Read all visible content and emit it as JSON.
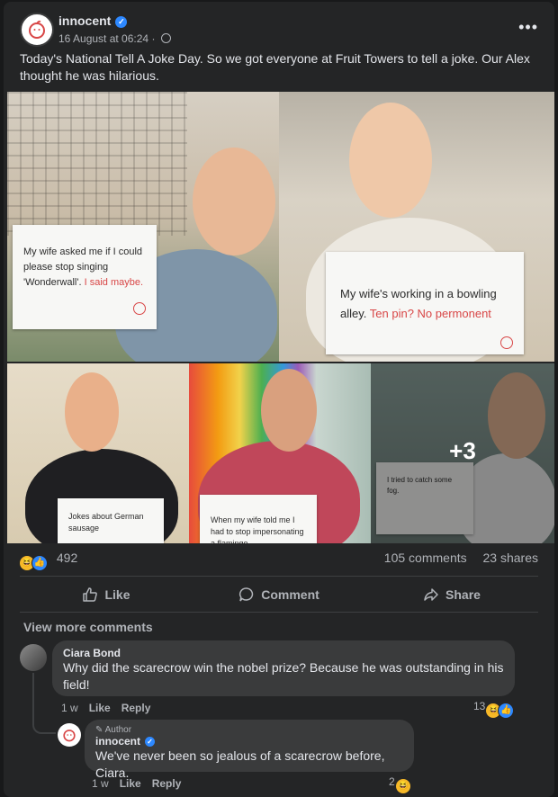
{
  "post": {
    "page_name": "innocent",
    "timestamp": "16 August at 06:24",
    "separator": "·",
    "more_menu": "•••",
    "text": "Today's National Tell A Joke Day. So we got everyone at Fruit Towers to tell a joke. Our Alex thought he was hilarious."
  },
  "photos": [
    {
      "sign_text": "My wife asked me if I could please stop singing 'Wonderwall'.",
      "sign_punchline": "I said maybe."
    },
    {
      "sign_text": "My wife's working in a bowling alley.",
      "sign_punchline": "Ten pin? No permonent"
    },
    {
      "sign_text": "Jokes about German sausage",
      "sign_punchline": ""
    },
    {
      "sign_text": "When my wife told me I had to stop impersonating a flamingo,",
      "sign_punchline": ""
    },
    {
      "sign_text": "I tried to catch some fog.",
      "sign_punchline": ""
    }
  ],
  "more_photos_label": "+3",
  "reactions": {
    "count": "492",
    "comments": "105 comments",
    "shares": "23 shares"
  },
  "actions": {
    "like": "Like",
    "comment": "Comment",
    "share": "Share"
  },
  "view_more_comments": "View more comments",
  "comments": [
    {
      "author": "Ciara Bond",
      "text": "Why did the scarecrow win the nobel prize? Because he was outstanding in his field!",
      "time": "1 w",
      "like": "Like",
      "reply": "Reply",
      "reaction_count": "13"
    },
    {
      "badge": "Author",
      "author": "innocent",
      "text": "We've never been so jealous of a scarecrow before, Ciara.",
      "time": "1 w",
      "like": "Like",
      "reply": "Reply",
      "reaction_count": "2"
    }
  ],
  "colors": {
    "background": "#18191a",
    "card": "#242526",
    "bubble": "#3a3b3c",
    "accent": "#2d88ff",
    "secondary_text": "#b0b3b8"
  }
}
